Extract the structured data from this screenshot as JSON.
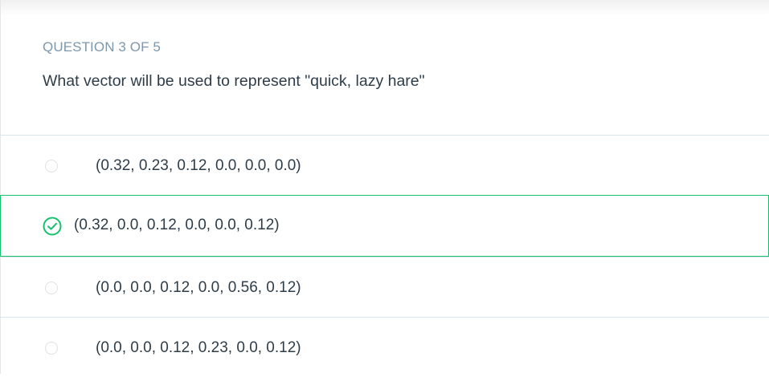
{
  "quiz": {
    "header": "QUESTION 3 OF 5",
    "question": "What vector will be used to represent \"quick, lazy hare\"",
    "accent_color": "#15c26b",
    "options": [
      {
        "label": "(0.32, 0.23, 0.12, 0.0, 0.0, 0.0)",
        "selected": false
      },
      {
        "label": "(0.32, 0.0, 0.12, 0.0, 0.0, 0.12)",
        "selected": true,
        "icon": "check-circle-icon"
      },
      {
        "label": "(0.0, 0.0, 0.12, 0.0, 0.56, 0.12)",
        "selected": false
      },
      {
        "label": "(0.0, 0.0, 0.12, 0.23, 0.0, 0.12)",
        "selected": false
      }
    ]
  }
}
